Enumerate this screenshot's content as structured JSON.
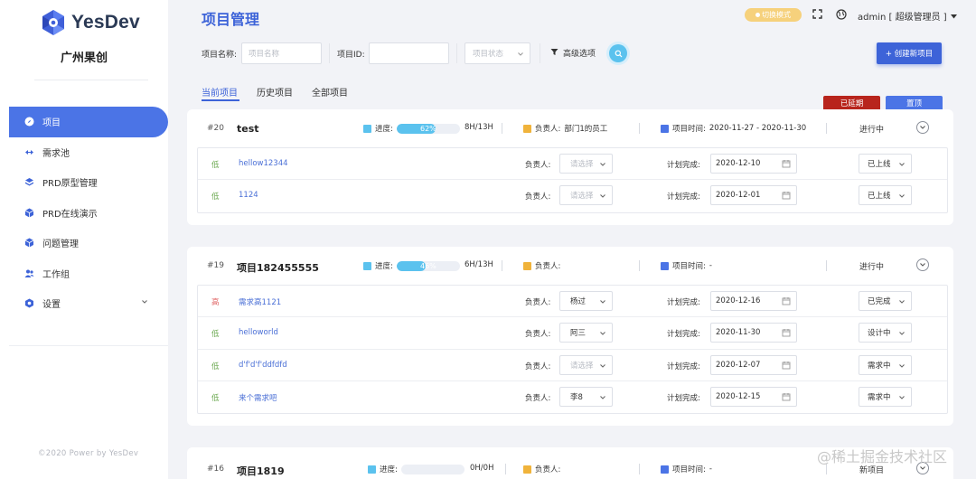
{
  "brand": {
    "name": "YesDev",
    "company": "广州果创",
    "footer": "©2020 Power by YesDev"
  },
  "nav": [
    {
      "label": "项目",
      "icon": "compass-icon",
      "active": true
    },
    {
      "label": "需求池",
      "icon": "arrows-icon"
    },
    {
      "label": "PRD原型管理",
      "icon": "layers-icon"
    },
    {
      "label": "PRD在线演示",
      "icon": "cube-icon"
    },
    {
      "label": "问题管理",
      "icon": "cube-icon"
    },
    {
      "label": "工作组",
      "icon": "users-icon"
    },
    {
      "label": "设置",
      "icon": "gear-icon",
      "has_children": true
    }
  ],
  "header": {
    "title": "项目管理",
    "switch_mode": "切换模式",
    "user": "admin [ 超级管理员 ]"
  },
  "filters": {
    "name_label": "项目名称:",
    "name_placeholder": "项目名称",
    "id_label": "项目ID:",
    "id_value": "",
    "status_placeholder": "项目状态",
    "advanced": "高级选项",
    "create": "+ 创建新项目"
  },
  "tabs": [
    "当前项目",
    "历史项目",
    "全部项目"
  ],
  "tags": {
    "delayed": "已延期",
    "pinned": "置顶"
  },
  "labels": {
    "progress": "进度:",
    "owner_head": "负责人:",
    "time_head": "项目时间:",
    "owner": "负责人:",
    "plan": "计划完成:"
  },
  "projects": [
    {
      "id": "#20",
      "name": "test",
      "progress": 62,
      "progress_text": "62%",
      "hours": "8H/13H",
      "owner": "部门1的员工",
      "time": "2020-11-27 - 2020-11-30",
      "status": "进行中",
      "rows": [
        {
          "priority": "低",
          "name": "hellow12344",
          "owner": "请选择",
          "owner_placeholder": true,
          "date": "2020-12-10",
          "status": "已上线"
        },
        {
          "priority": "低",
          "name": "1124",
          "owner": "请选择",
          "owner_placeholder": true,
          "date": "2020-12-01",
          "status": "已上线"
        }
      ]
    },
    {
      "id": "#19",
      "name": "项目182455555",
      "progress": 46,
      "progress_text": "46%",
      "hours": "6H/13H",
      "owner": "",
      "time": "-",
      "status": "进行中",
      "rows": [
        {
          "priority": "高",
          "name": "需求高1121",
          "owner": "杨过",
          "owner_placeholder": false,
          "date": "2020-12-16",
          "status": "已完成"
        },
        {
          "priority": "低",
          "name": "helloworld",
          "owner": "阿三",
          "owner_placeholder": false,
          "date": "2020-11-30",
          "status": "设计中"
        },
        {
          "priority": "低",
          "name": "d'f'd'f'ddfdfd",
          "owner": "请选择",
          "owner_placeholder": true,
          "date": "2020-12-07",
          "status": "需求中"
        },
        {
          "priority": "低",
          "name": "来个需求吧",
          "owner": "李8",
          "owner_placeholder": false,
          "date": "2020-12-15",
          "status": "需求中"
        }
      ]
    },
    {
      "id": "#16",
      "name": "项目1819",
      "progress": 0,
      "progress_text": "",
      "hours": "0H/0H",
      "owner": "",
      "time": "-",
      "status": "新项目",
      "rows": []
    }
  ],
  "colors": {
    "accent": "#3d63d8",
    "progress": "#5bc2ee",
    "priority_low": "#6aa84f",
    "priority_high": "#e06666",
    "delayed": "#b8241c"
  },
  "watermark": "@稀土掘金技术社区"
}
